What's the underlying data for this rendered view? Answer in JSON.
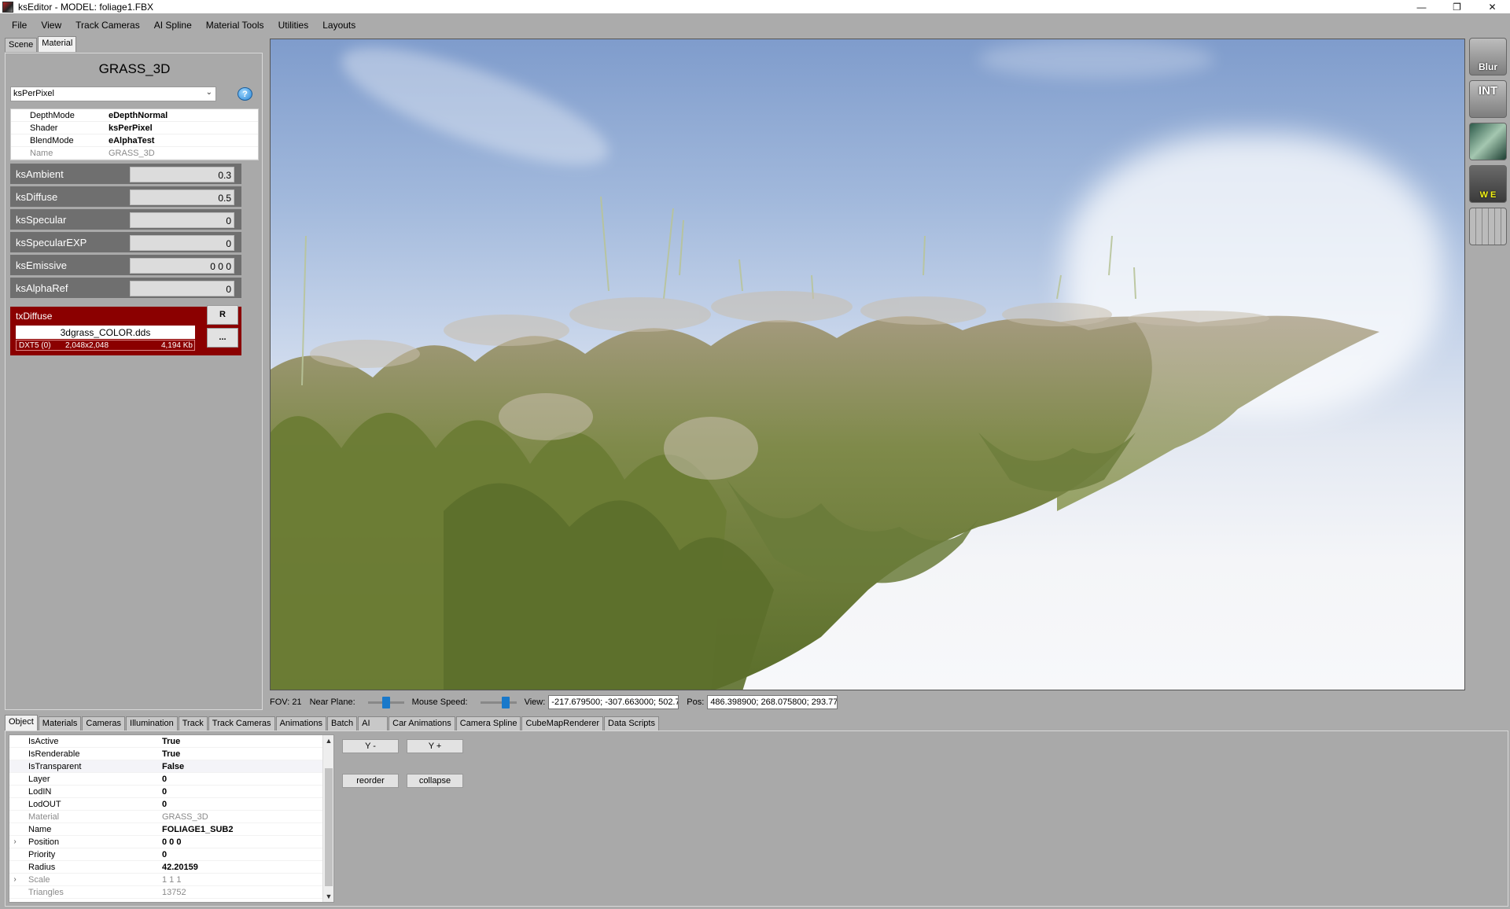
{
  "window": {
    "title": "ksEditor - MODEL: foliage1.FBX",
    "minimize": "—",
    "restore": "❐",
    "close": "✕"
  },
  "menu": [
    "File",
    "View",
    "Track Cameras",
    "AI Spline",
    "Material Tools",
    "Utilities",
    "Layouts"
  ],
  "left_tabs": [
    "Scene",
    "Material"
  ],
  "material": {
    "name": "GRASS_3D",
    "shader_select": "ksPerPixel",
    "properties": [
      {
        "key": "DepthMode",
        "value": "eDepthNormal"
      },
      {
        "key": "Shader",
        "value": "ksPerPixel"
      },
      {
        "key": "BlendMode",
        "value": "eAlphaTest"
      },
      {
        "key": "Name",
        "value": "GRASS_3D"
      }
    ],
    "params": [
      {
        "label": "ksAmbient",
        "value": "0.3"
      },
      {
        "label": "ksDiffuse",
        "value": "0.5"
      },
      {
        "label": "ksSpecular",
        "value": "0"
      },
      {
        "label": "ksSpecularEXP",
        "value": "0"
      },
      {
        "label": "ksEmissive",
        "value": "0 0 0"
      },
      {
        "label": "ksAlphaRef",
        "value": "0"
      }
    ],
    "texture": {
      "label": "txDiffuse",
      "file": "3dgrass_COLOR.dds",
      "format": "DXT5 (0)",
      "dims": "2,048x2,048",
      "size": "4,194 Kb",
      "btn_r": "R",
      "btn_more": "..."
    }
  },
  "toolbar_right": [
    {
      "label": "Blur",
      "icon": "blur-wheel-icon"
    },
    {
      "label": "INT",
      "icon": "hr-lr-icon"
    },
    {
      "label": "",
      "icon": "texture-icon"
    },
    {
      "label": "W E",
      "icon": "wind-icon"
    },
    {
      "label": "",
      "icon": "grid-icon"
    }
  ],
  "status": {
    "fov": "FOV: 21",
    "near_plane": "Near Plane:",
    "mouse_speed": "Mouse Speed:",
    "view_label": "View:",
    "view_value": "-217.679500; -307.663000; 502.7",
    "pos_label": "Pos:",
    "pos_value": "486.398900; 268.075800; 293.77",
    "near_plane_level": 0.5,
    "mouse_speed_level": 0.75
  },
  "bottom_tabs": [
    "Object",
    "Materials",
    "Cameras",
    "Illumination",
    "Track",
    "Track Cameras",
    "Animations",
    "Batch",
    "AI",
    "Car Animations",
    "Camera Spline",
    "CubeMapRenderer",
    "Data Scripts"
  ],
  "object_props": [
    {
      "key": "IsActive",
      "value": "True",
      "dim": false,
      "expand": ""
    },
    {
      "key": "IsRenderable",
      "value": "True",
      "dim": false,
      "expand": ""
    },
    {
      "key": "IsTransparent",
      "value": "False",
      "dim": false,
      "expand": ""
    },
    {
      "key": "Layer",
      "value": "0",
      "dim": false,
      "expand": ""
    },
    {
      "key": "LodIN",
      "value": "0",
      "dim": false,
      "expand": ""
    },
    {
      "key": "LodOUT",
      "value": "0",
      "dim": false,
      "expand": ""
    },
    {
      "key": "Material",
      "value": "GRASS_3D",
      "dim": true,
      "expand": ""
    },
    {
      "key": "Name",
      "value": "FOLIAGE1_SUB2",
      "dim": false,
      "expand": ""
    },
    {
      "key": "Position",
      "value": "0 0 0",
      "dim": false,
      "expand": "›"
    },
    {
      "key": "Priority",
      "value": "0",
      "dim": false,
      "expand": ""
    },
    {
      "key": "Radius",
      "value": "42.20159",
      "dim": false,
      "expand": ""
    },
    {
      "key": "Scale",
      "value": "1 1 1",
      "dim": true,
      "expand": "›"
    },
    {
      "key": "Triangles",
      "value": "13752",
      "dim": true,
      "expand": ""
    }
  ],
  "object_buttons": {
    "y_minus": "Y -",
    "y_plus": "Y +",
    "reorder": "reorder",
    "collapse": "collapse"
  }
}
